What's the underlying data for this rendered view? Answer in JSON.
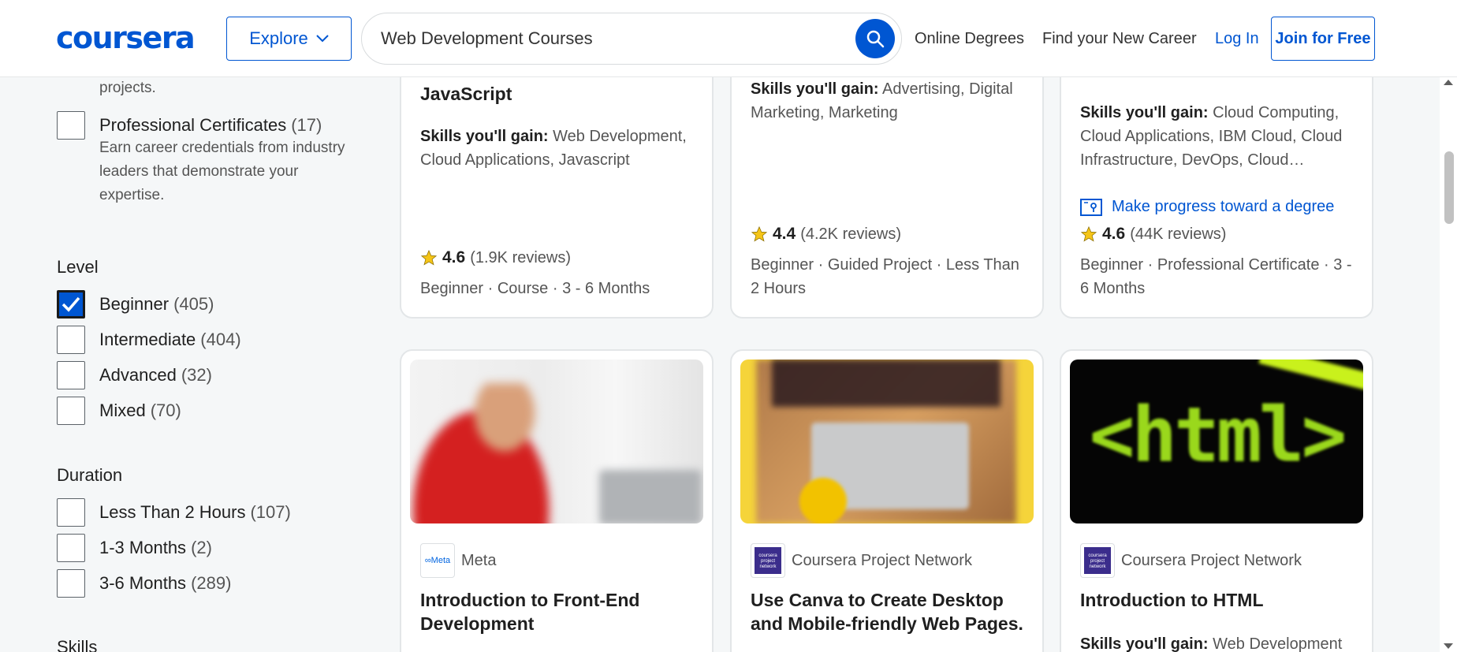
{
  "header": {
    "logo": "coursera",
    "explore_label": "Explore",
    "search_value": "Web Development Courses",
    "nav": [
      "Online Degrees",
      "Find your New Career"
    ],
    "login": "Log In",
    "join": "Join for Free"
  },
  "sidebar": {
    "top_desc": "projects.",
    "prof_cert": {
      "label": "Professional Certificates",
      "count": "(17)",
      "desc": "Earn career credentials from industry leaders that demonstrate your expertise."
    },
    "level_title": "Level",
    "levels": [
      {
        "label": "Beginner",
        "count": "(405)",
        "checked": true
      },
      {
        "label": "Intermediate",
        "count": "(404)",
        "checked": false
      },
      {
        "label": "Advanced",
        "count": "(32)",
        "checked": false
      },
      {
        "label": "Mixed",
        "count": "(70)",
        "checked": false
      }
    ],
    "duration_title": "Duration",
    "durations": [
      {
        "label": "Less Than 2 Hours",
        "count": "(107)"
      },
      {
        "label": "1-3 Months",
        "count": "(2)"
      },
      {
        "label": "3-6 Months",
        "count": "(289)"
      }
    ],
    "skills_title": "Skills"
  },
  "cards_top": [
    {
      "title_tail": "JavaScript",
      "skills_label": "Skills you'll gain:",
      "skills": "Web Development, Cloud Applications, Javascript",
      "rating": "4.6",
      "reviews": "(1.9K reviews)",
      "meta": "Beginner · Course · 3 - 6 Months"
    },
    {
      "skills_label": "Skills you'll gain:",
      "skills": "Advertising, Digital Marketing, Marketing",
      "rating": "4.4",
      "reviews": "(4.2K reviews)",
      "meta": "Beginner · Guided Project · Less Than 2 Hours"
    },
    {
      "skills_label": "Skills you'll gain:",
      "skills": "Cloud Computing, Cloud Applications, IBM Cloud, Cloud Infrastructure, DevOps, Cloud…",
      "degree_link": "Make progress toward a degree",
      "rating": "4.6",
      "reviews": "(44K reviews)",
      "meta": "Beginner · Professional Certificate · 3 - 6 Months"
    }
  ],
  "cards_bottom": [
    {
      "partner": "Meta",
      "partner_logo": "∞Meta",
      "title": "Introduction to Front-End Development"
    },
    {
      "partner": "Coursera Project Network",
      "partner_logo": "coursera project network",
      "title": "Use Canva to Create Desktop and Mobile-friendly Web Pages."
    },
    {
      "partner": "Coursera Project Network",
      "partner_logo": "coursera project network",
      "title": "Introduction to HTML",
      "skills_label": "Skills you'll gain:",
      "skills": "Web Development",
      "thumb_text": "<html>"
    }
  ],
  "colors": {
    "brand": "#0056d2",
    "star": "#f5c518"
  }
}
